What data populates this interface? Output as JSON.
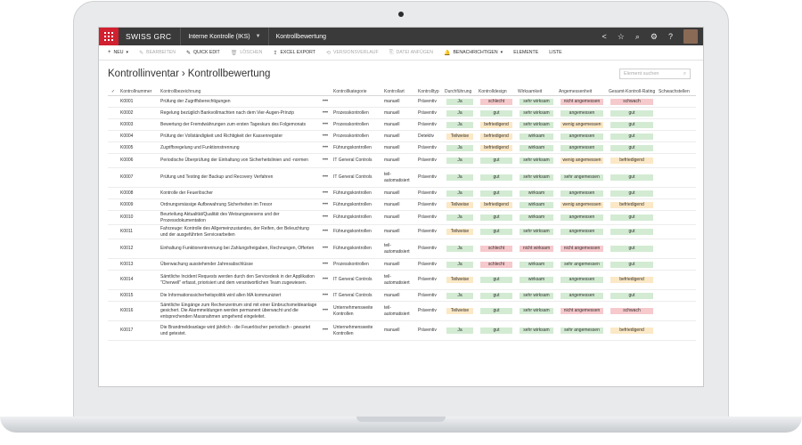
{
  "app": {
    "brand": "SWISS GRC",
    "context": "Interne Kontrolle (IKS)",
    "page": "Kontrollbewertung"
  },
  "toolbar": {
    "items": [
      {
        "icon": "+",
        "label": "NEU",
        "caret": true,
        "disabled": false
      },
      {
        "icon": "✎",
        "label": "BEARBEITEN",
        "caret": false,
        "disabled": true
      },
      {
        "icon": "✎",
        "label": "QUICK EDIT",
        "caret": false,
        "disabled": false
      },
      {
        "icon": "🗑",
        "label": "LÖSCHEN",
        "caret": false,
        "disabled": true
      },
      {
        "icon": "⇪",
        "label": "EXCEL EXPORT",
        "caret": false,
        "disabled": false
      },
      {
        "icon": "⟲",
        "label": "VERSIONSVERLAUF",
        "caret": false,
        "disabled": true
      },
      {
        "icon": "⎘",
        "label": "DATEI ANFÜGEN",
        "caret": false,
        "disabled": true
      },
      {
        "icon": "🔔",
        "label": "BENACHRICHTIGEN",
        "caret": true,
        "disabled": false
      },
      {
        "icon": "",
        "label": "ELEMENTE",
        "caret": false,
        "disabled": false
      },
      {
        "icon": "",
        "label": "LISTE",
        "caret": false,
        "disabled": false
      }
    ]
  },
  "breadcrumb": {
    "root": "Kontrollinventar",
    "separator": "›",
    "current": "Kontrollbewertung"
  },
  "search": {
    "placeholder": "Element suchen"
  },
  "table": {
    "columns": [
      "Kontrollnummer",
      "Kontrollbezeichnung",
      "",
      "Kontrollkategorie",
      "Kontrollart",
      "Kontrolltyp",
      "Durchführung",
      "Kontrolldesign",
      "Wirksamkeit",
      "Angemessenheit",
      "Gesamt-Kontroll-Rating",
      "Schwachstellen"
    ],
    "rows": [
      {
        "h": "h1",
        "num": "K0001",
        "name": "Prüfung der Zugriffsberechtigungen",
        "cat": "",
        "art": "manuell",
        "typ": "Präventiv",
        "durch": "Ja",
        "durch_c": "good",
        "design": "schlecht",
        "design_c": "bad",
        "wirk": "sehr wirksam",
        "wirk_c": "good",
        "ang": "nicht angemessen",
        "ang_c": "bad",
        "rating": "schwach",
        "rating_c": "bad"
      },
      {
        "h": "h1",
        "num": "K0002",
        "name": "Regelung bezüglich Bankvollmachten nach dem Vier-Augen-Prinzip",
        "cat": "Prozesskontrollen",
        "art": "manuell",
        "typ": "Präventiv",
        "durch": "Ja",
        "durch_c": "good",
        "design": "gut",
        "design_c": "good",
        "wirk": "sehr wirksam",
        "wirk_c": "good",
        "ang": "angemessen",
        "ang_c": "good",
        "rating": "gut",
        "rating_c": "good"
      },
      {
        "h": "h1",
        "num": "K0003",
        "name": "Bewertung der Fremdwährungen zum ersten Tageskurs des Folgemonats",
        "cat": "Prozesskontrollen",
        "art": "manuell",
        "typ": "Präventiv",
        "durch": "Ja",
        "durch_c": "good",
        "design": "befriedigend",
        "design_c": "ok",
        "wirk": "sehr wirksam",
        "wirk_c": "good",
        "ang": "wenig angemessen",
        "ang_c": "ok",
        "rating": "gut",
        "rating_c": "good"
      },
      {
        "h": "h1",
        "num": "K0004",
        "name": "Prüfung der Vollständigkeit und Richtigkeit der Kassenregister",
        "cat": "Prozesskontrollen",
        "art": "manuell",
        "typ": "Detektiv",
        "durch": "Teilweise",
        "durch_c": "ok",
        "design": "befriedigend",
        "design_c": "ok",
        "wirk": "wirksam",
        "wirk_c": "good",
        "ang": "angemessen",
        "ang_c": "good",
        "rating": "gut",
        "rating_c": "good"
      },
      {
        "h": "h1",
        "num": "K0005",
        "name": "Zugriffsregelung und Funktionstrennung",
        "cat": "Führungskontrollen",
        "art": "manuell",
        "typ": "Präventiv",
        "durch": "Ja",
        "durch_c": "good",
        "design": "befriedigend",
        "design_c": "ok",
        "wirk": "wirksam",
        "wirk_c": "good",
        "ang": "angemessen",
        "ang_c": "good",
        "rating": "gut",
        "rating_c": "good"
      },
      {
        "h": "h2",
        "num": "K0006",
        "name": "Periodische Überprüfung der Einhaltung von Sicherheitslinien und -normen",
        "cat": "IT General Controls",
        "art": "manuell",
        "typ": "Präventiv",
        "durch": "Ja",
        "durch_c": "good",
        "design": "gut",
        "design_c": "good",
        "wirk": "sehr wirksam",
        "wirk_c": "good",
        "ang": "wenig angemessen",
        "ang_c": "ok",
        "rating": "befriedigend",
        "rating_c": "ok"
      },
      {
        "h": "h3",
        "num": "K0007",
        "name": "Prüfung und Testing der Backup und Recovery Verfahren",
        "cat": "IT General Controls",
        "art": "teil-automatisiert",
        "typ": "Präventiv",
        "durch": "Ja",
        "durch_c": "good",
        "design": "gut",
        "design_c": "good",
        "wirk": "sehr wirksam",
        "wirk_c": "good",
        "ang": "sehr angemessen",
        "ang_c": "good",
        "rating": "gut",
        "rating_c": "good"
      },
      {
        "h": "h1",
        "num": "K0008",
        "name": "Kontrolle der Feuerlöscher",
        "cat": "Führungskontrollen",
        "art": "manuell",
        "typ": "Präventiv",
        "durch": "Ja",
        "durch_c": "good",
        "design": "gut",
        "design_c": "good",
        "wirk": "wirksam",
        "wirk_c": "good",
        "ang": "angemessen",
        "ang_c": "good",
        "rating": "gut",
        "rating_c": "good"
      },
      {
        "h": "h1",
        "num": "K0009",
        "name": "Ordnungsmässige Aufbewahrung Sicherheiten im Tresor",
        "cat": "Führungskontrollen",
        "art": "manuell",
        "typ": "Präventiv",
        "durch": "Teilweise",
        "durch_c": "ok",
        "design": "befriedigend",
        "design_c": "ok",
        "wirk": "wirksam",
        "wirk_c": "good",
        "ang": "wenig angemessen",
        "ang_c": "ok",
        "rating": "befriedigend",
        "rating_c": "ok"
      },
      {
        "h": "h2",
        "num": "K0010",
        "name": "Beurteilung Aktualität/Qualität des Weisungswesens und der Prozessdokumentation",
        "cat": "Führungskontrollen",
        "art": "manuell",
        "typ": "Präventiv",
        "durch": "Ja",
        "durch_c": "good",
        "design": "gut",
        "design_c": "good",
        "wirk": "wirksam",
        "wirk_c": "good",
        "ang": "angemessen",
        "ang_c": "good",
        "rating": "gut",
        "rating_c": "good"
      },
      {
        "h": "h2",
        "num": "K0011",
        "name": "Fahrzeuge: Kontrolle des Allgemeinzustandes, der Reifen, der Beleuchtung und der ausgeführten Servicearbeiten",
        "cat": "Führungskontrollen",
        "art": "manuell",
        "typ": "Präventiv",
        "durch": "Teilweise",
        "durch_c": "ok",
        "design": "gut",
        "design_c": "good",
        "wirk": "sehr wirksam",
        "wirk_c": "good",
        "ang": "angemessen",
        "ang_c": "good",
        "rating": "gut",
        "rating_c": "good"
      },
      {
        "h": "h3",
        "num": "K0012",
        "name": "Einhaltung Funktionentrennung bei Zahlungsfreigaben, Rechnungen, Offerten",
        "cat": "Führungskontrollen",
        "art": "teil-automatisiert",
        "typ": "Präventiv",
        "durch": "Ja",
        "durch_c": "good",
        "design": "schlecht",
        "design_c": "bad",
        "wirk": "nicht wirksam",
        "wirk_c": "bad",
        "ang": "nicht angemessen",
        "ang_c": "bad",
        "rating": "gut",
        "rating_c": "good"
      },
      {
        "h": "h1",
        "num": "K0013",
        "name": "Überwachung ausstehender Jahresabschlüsse",
        "cat": "Prozesskontrollen",
        "art": "manuell",
        "typ": "Präventiv",
        "durch": "Ja",
        "durch_c": "good",
        "design": "schlecht",
        "design_c": "bad",
        "wirk": "wirksam",
        "wirk_c": "good",
        "ang": "sehr angemessen",
        "ang_c": "good",
        "rating": "gut",
        "rating_c": "good"
      },
      {
        "h": "h3",
        "num": "K0014",
        "name": "Sämtliche Incident Requests werden durch den Servicedesk in der Applikation \"Cherwell\" erfasst, priorisiert und dem verantwortlichen Team zugewiesen.",
        "cat": "IT General Controls",
        "art": "teil-automatisiert",
        "typ": "Präventiv",
        "durch": "Teilweise",
        "durch_c": "ok",
        "design": "gut",
        "design_c": "good",
        "wirk": "wirksam",
        "wirk_c": "good",
        "ang": "angemessen",
        "ang_c": "good",
        "rating": "befriedigend",
        "rating_c": "ok"
      },
      {
        "h": "h1",
        "num": "K0015",
        "name": "Die Informationssicherheitspolitik wird allen MA kommuniziert",
        "cat": "IT General Controls",
        "art": "manuell",
        "typ": "Präventiv",
        "durch": "Ja",
        "durch_c": "good",
        "design": "gut",
        "design_c": "good",
        "wirk": "sehr wirksam",
        "wirk_c": "good",
        "ang": "angemessen",
        "ang_c": "good",
        "rating": "gut",
        "rating_c": "good"
      },
      {
        "h": "h3",
        "num": "K0016",
        "name": "Sämtliche Eingänge zum Rechenzentrum sind mit einer Einbruchsmeldeanlage gesichert. Die Alarmmeldungen werden permanent überwacht und die entsprechenden Massnahmen umgehend eingeleitet.",
        "cat": "Unternehmensweite Kontrollen",
        "art": "teil-automatisiert",
        "typ": "Präventiv",
        "durch": "Teilweise",
        "durch_c": "ok",
        "design": "gut",
        "design_c": "good",
        "wirk": "sehr wirksam",
        "wirk_c": "good",
        "ang": "nicht angemessen",
        "ang_c": "bad",
        "rating": "schwach",
        "rating_c": "bad"
      },
      {
        "h": "h3",
        "num": "K0017",
        "name": "Die Brandmeldeanlage wird jährlich - die Feuerlöscher periodisch - gewartet und getestet.",
        "cat": "Unternehmensweite Kontrollen",
        "art": "manuell",
        "typ": "Präventiv",
        "durch": "Ja",
        "durch_c": "good",
        "design": "gut",
        "design_c": "good",
        "wirk": "sehr wirksam",
        "wirk_c": "good",
        "ang": "sehr angemessen",
        "ang_c": "good",
        "rating": "befriedigend",
        "rating_c": "ok"
      }
    ]
  }
}
